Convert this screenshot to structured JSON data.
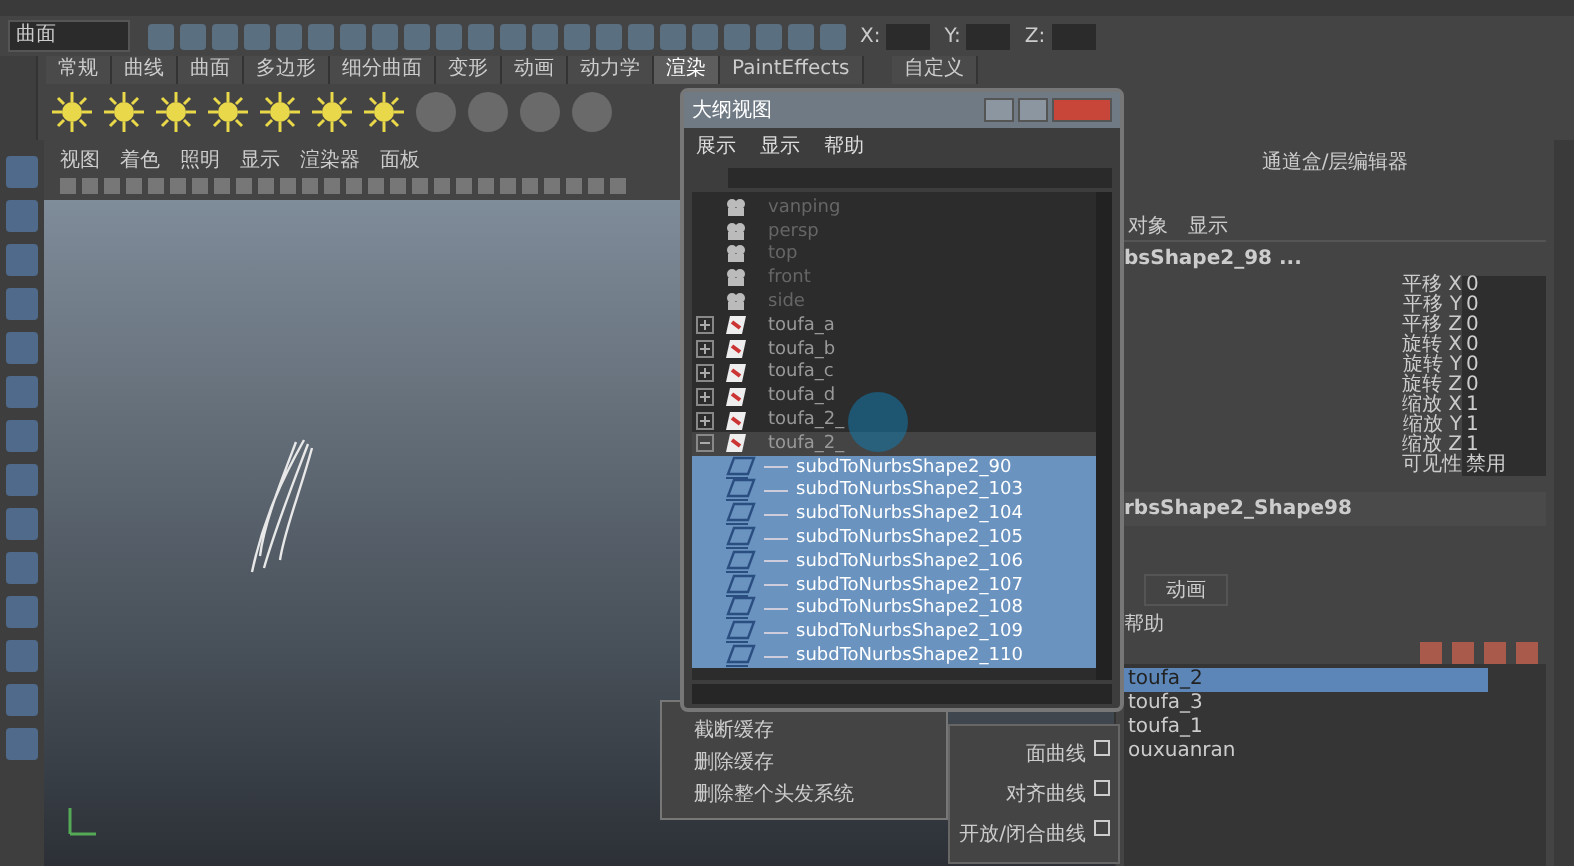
{
  "toolbar": {
    "mode_dropdown": "曲面",
    "coords": [
      {
        "label": "X:"
      },
      {
        "label": "Y:"
      },
      {
        "label": "Z:"
      }
    ]
  },
  "shelf_tabs": [
    {
      "label": "常规",
      "selected": false
    },
    {
      "label": "曲线",
      "selected": false
    },
    {
      "label": "曲面",
      "selected": false
    },
    {
      "label": "多边形",
      "selected": false
    },
    {
      "label": "细分曲面",
      "selected": false
    },
    {
      "label": "变形",
      "selected": false
    },
    {
      "label": "动画",
      "selected": false
    },
    {
      "label": "动力学",
      "selected": false
    },
    {
      "label": "渲染",
      "selected": true
    },
    {
      "label": "PaintEffects",
      "selected": false
    },
    {
      "label": "自定义",
      "selected": false
    }
  ],
  "viewport": {
    "menus": [
      "视图",
      "着色",
      "照明",
      "显示",
      "渲染器",
      "面板"
    ]
  },
  "channel_box": {
    "title": "通道盒/层编辑器",
    "menus": [
      "对象",
      "显示"
    ],
    "object_name": "bsShape2_98 ...",
    "channels": [
      {
        "label": "平移 X",
        "value": "0"
      },
      {
        "label": "平移 Y",
        "value": "0"
      },
      {
        "label": "平移 Z",
        "value": "0"
      },
      {
        "label": "旋转 X",
        "value": "0"
      },
      {
        "label": "旋转 Y",
        "value": "0"
      },
      {
        "label": "旋转 Z",
        "value": "0"
      },
      {
        "label": "缩放 X",
        "value": "1"
      },
      {
        "label": "缩放 Y",
        "value": "1"
      },
      {
        "label": "缩放 Z",
        "value": "1"
      },
      {
        "label": "可见性",
        "value": "禁用"
      }
    ],
    "shape_name": "rbsShape2_Shape98"
  },
  "layer_editor": {
    "tab": "动画",
    "help": "帮助",
    "layers": [
      {
        "name": "toufa_2",
        "selected": true
      },
      {
        "name": "toufa_3",
        "selected": false
      },
      {
        "name": "toufa_1",
        "selected": false
      },
      {
        "name": "ouxuanran",
        "selected": false
      }
    ]
  },
  "outliner": {
    "title": "大纲视图",
    "menus": [
      "展示",
      "显示",
      "帮助"
    ],
    "items": [
      {
        "name": "vanping",
        "kind": "camera"
      },
      {
        "name": "persp",
        "kind": "camera"
      },
      {
        "name": "top",
        "kind": "camera"
      },
      {
        "name": "front",
        "kind": "camera"
      },
      {
        "name": "side",
        "kind": "camera"
      },
      {
        "name": "toufa_a",
        "kind": "group",
        "expanded": false
      },
      {
        "name": "toufa_b",
        "kind": "group",
        "expanded": false
      },
      {
        "name": "toufa_c",
        "kind": "group",
        "expanded": false
      },
      {
        "name": "toufa_d",
        "kind": "group",
        "expanded": false
      },
      {
        "name": "toufa_2_",
        "kind": "group",
        "expanded": false
      },
      {
        "name": "toufa_2_",
        "kind": "group",
        "expanded": true,
        "children": [
          {
            "name": "subdToNurbsShape2_90",
            "kind": "curve",
            "selected": true
          },
          {
            "name": "subdToNurbsShape2_103",
            "kind": "curve",
            "selected": true
          },
          {
            "name": "subdToNurbsShape2_104",
            "kind": "curve",
            "selected": true
          },
          {
            "name": "subdToNurbsShape2_105",
            "kind": "curve",
            "selected": true
          },
          {
            "name": "subdToNurbsShape2_106",
            "kind": "curve",
            "selected": true
          },
          {
            "name": "subdToNurbsShape2_107",
            "kind": "curve",
            "selected": true
          },
          {
            "name": "subdToNurbsShape2_108",
            "kind": "curve",
            "selected": true
          },
          {
            "name": "subdToNurbsShape2_109",
            "kind": "curve",
            "selected": true
          },
          {
            "name": "subdToNurbsShape2_110",
            "kind": "curve",
            "selected": true
          }
        ]
      }
    ]
  },
  "hair_menu": {
    "items": [
      "截断缓存",
      "删除缓存",
      "删除整个头发系统"
    ]
  },
  "curve_menu": {
    "items": [
      "面曲线",
      "对齐曲线",
      "开放/闭合曲线"
    ]
  }
}
